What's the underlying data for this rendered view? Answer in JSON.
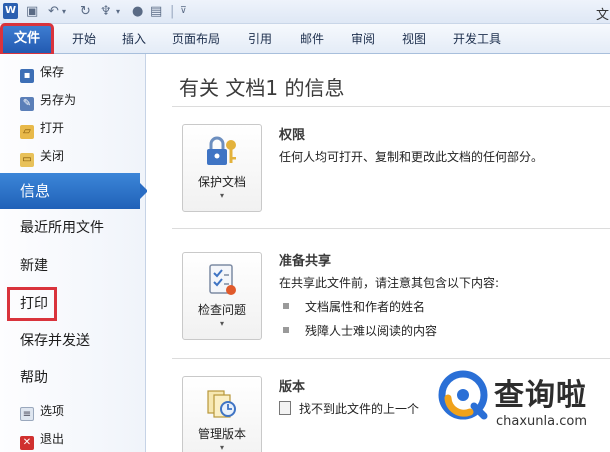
{
  "app": {
    "logo_letter": "W",
    "title_fragment": "文"
  },
  "ribbon": {
    "tabs": [
      "文件",
      "开始",
      "插入",
      "页面布局",
      "引用",
      "邮件",
      "审阅",
      "视图",
      "开发工具"
    ]
  },
  "nav": {
    "small_top": [
      {
        "label": "保存",
        "icon": "save-icon"
      },
      {
        "label": "另存为",
        "icon": "save-as-icon"
      },
      {
        "label": "打开",
        "icon": "open-folder-icon"
      },
      {
        "label": "关闭",
        "icon": "close-folder-icon"
      }
    ],
    "info": "信息",
    "recent": "最近所用文件",
    "new": "新建",
    "print": "打印",
    "save_send": "保存并发送",
    "help": "帮助",
    "small_bottom": [
      {
        "label": "选项",
        "icon": "options-icon"
      },
      {
        "label": "退出",
        "icon": "exit-icon"
      }
    ]
  },
  "main": {
    "title": "有关 文档1 的信息",
    "sections": [
      {
        "button": "保护文档",
        "icon": "lock-key-icon",
        "title": "权限",
        "desc": "任何人均可打开、复制和更改此文档的任何部分。"
      },
      {
        "button": "检查问题",
        "icon": "checklist-icon",
        "title": "准备共享",
        "desc": "在共享此文件前，请注意其包含以下内容:",
        "bullets": [
          "文档属性和作者的姓名",
          "残障人士难以阅读的内容"
        ]
      },
      {
        "button": "管理版本",
        "icon": "versions-icon",
        "title": "版本",
        "desc": "找不到此文件的上一个"
      }
    ]
  },
  "watermark": {
    "brand": "查询啦",
    "url": "chaxunla.com"
  },
  "colors": {
    "accent": "#2a6dc4",
    "highlight": "#d9333c"
  }
}
